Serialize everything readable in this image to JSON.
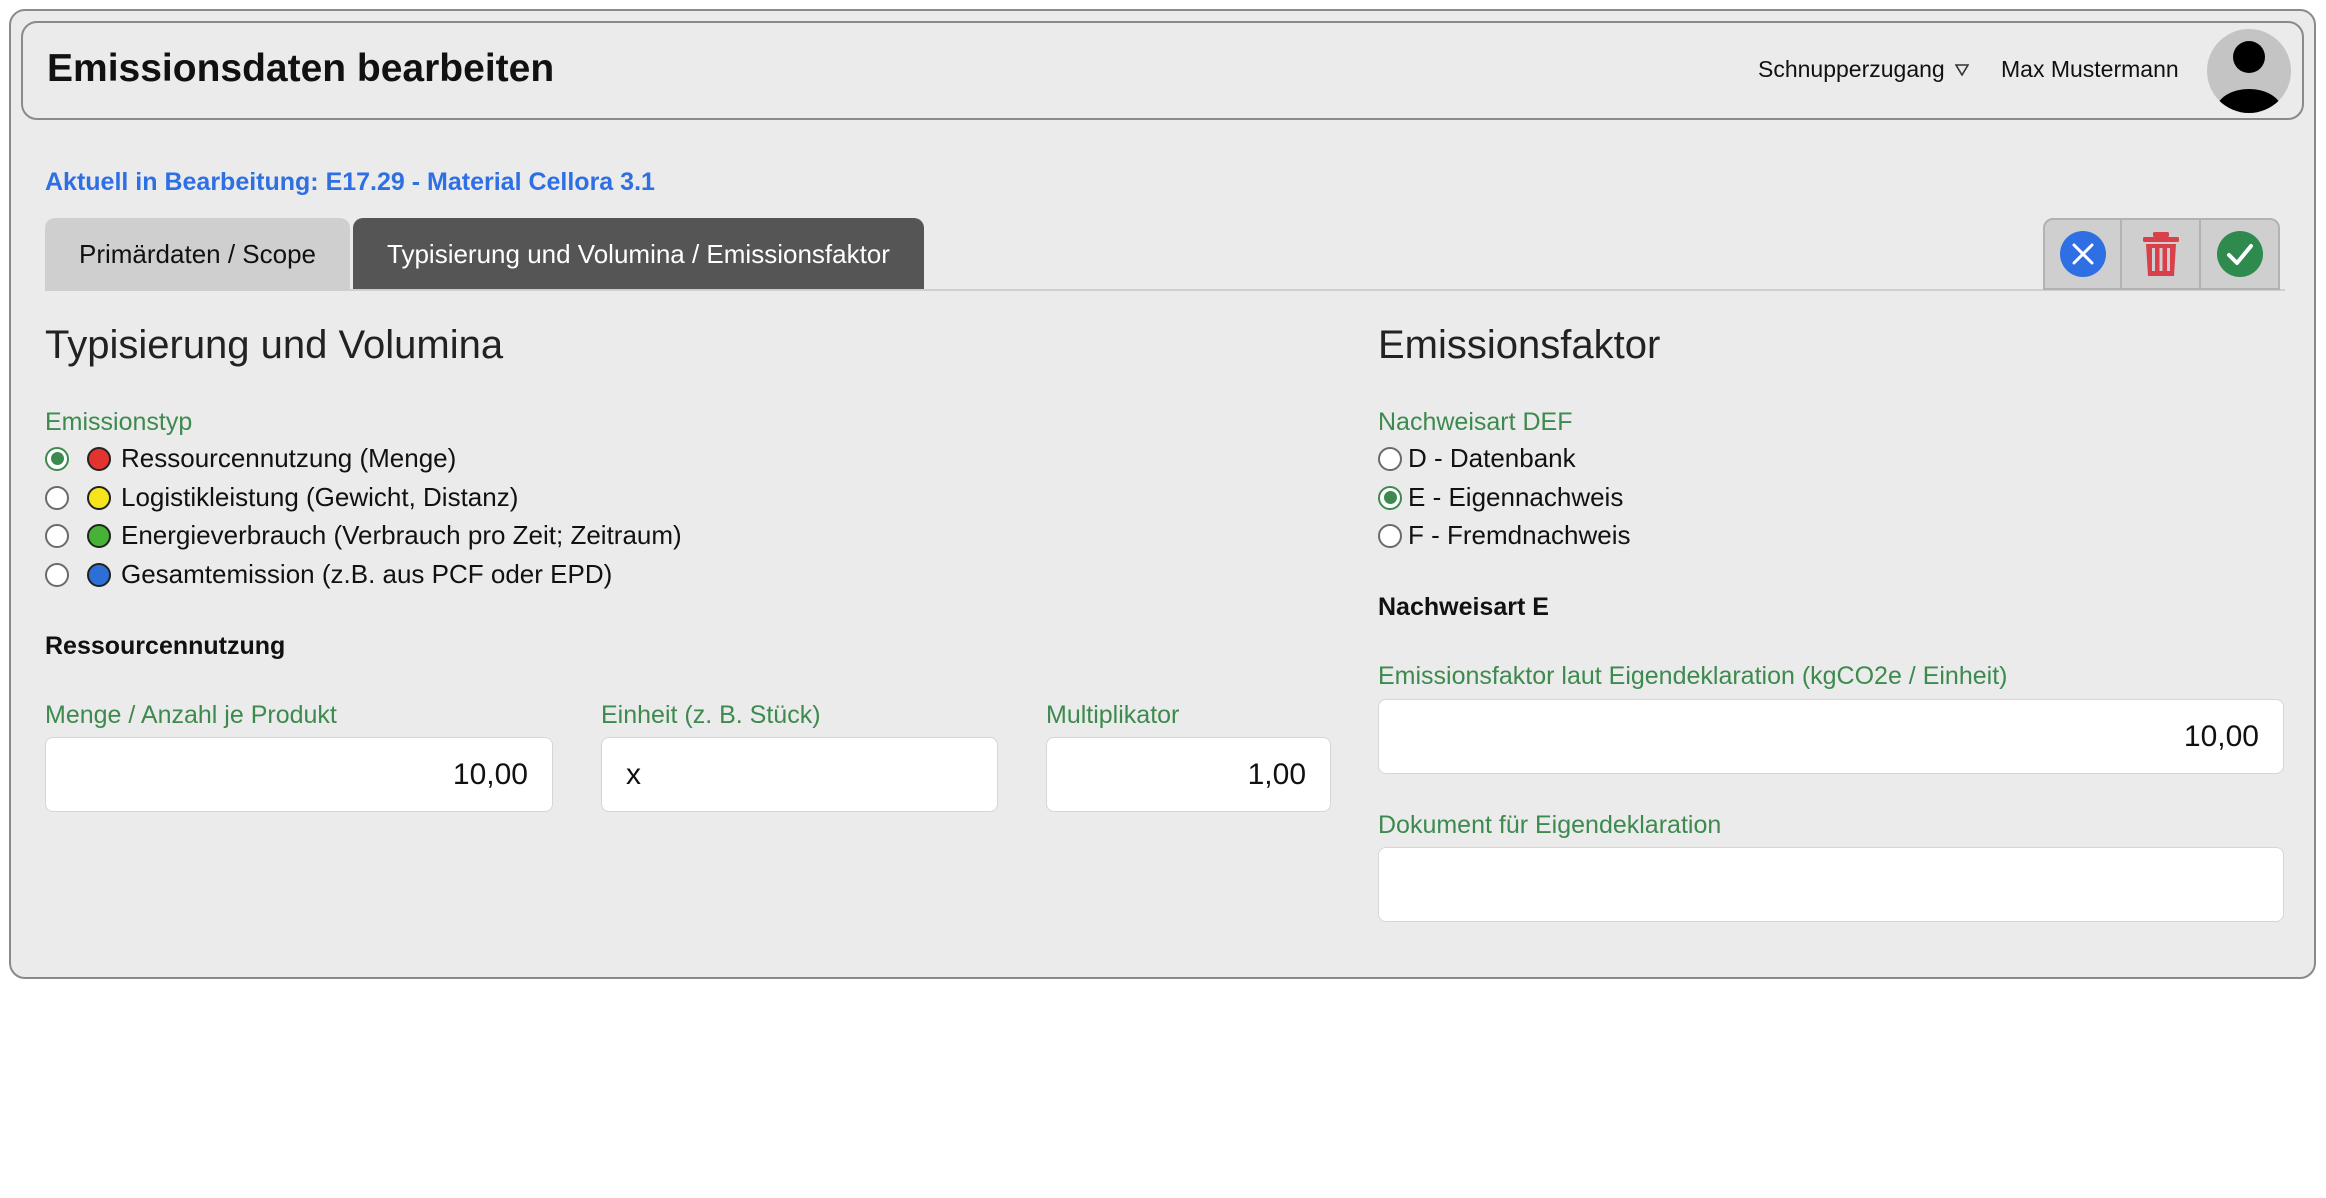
{
  "header": {
    "title": "Emissionsdaten bearbeiten",
    "account": "Schnupperzugang",
    "user_name": "Max Mustermann"
  },
  "editing": "Aktuell in Bearbeitung: E17.29 - Material Cellora 3.1",
  "tabs": [
    {
      "label": "Primärdaten / Scope",
      "active": false
    },
    {
      "label": "Typisierung und Volumina / Emissionsfaktor",
      "active": true
    }
  ],
  "actions": {
    "cancel_icon": "close-icon",
    "delete_icon": "trash-icon",
    "confirm_icon": "check-icon"
  },
  "left": {
    "title": "Typisierung und Volumina",
    "emission_type_label": "Emissionstyp",
    "emission_types": [
      {
        "label": "Ressourcennutzung (Menge)",
        "color": "#e2332e",
        "checked": true
      },
      {
        "label": "Logistikleistung (Gewicht, Distanz)",
        "color": "#f5e51d",
        "checked": false
      },
      {
        "label": "Energieverbrauch (Verbrauch pro Zeit; Zeitraum)",
        "color": "#46b336",
        "checked": false
      },
      {
        "label": "Gesamtemission (z.B. aus PCF oder EPD)",
        "color": "#2d6fd6",
        "checked": false
      }
    ],
    "subsection": "Ressourcennutzung",
    "fields": {
      "quantity_label": "Menge / Anzahl je Produkt",
      "quantity_value": "10,00",
      "unit_label": "Einheit (z. B. Stück)",
      "unit_value": "x",
      "multiplier_label": "Multiplikator",
      "multiplier_value": "1,00"
    }
  },
  "right": {
    "title": "Emissionsfaktor",
    "proof_label": "Nachweisart DEF",
    "proof_options": [
      {
        "label": "D - Datenbank",
        "checked": false
      },
      {
        "label": "E - Eigennachweis",
        "checked": true
      },
      {
        "label": "F - Fremdnachweis",
        "checked": false
      }
    ],
    "subsection": "Nachweisart E",
    "factor_label": "Emissionsfaktor laut Eigendeklaration (kgCO2e / Einheit)",
    "factor_value": "10,00",
    "document_label": "Dokument für Eigendeklaration",
    "document_value": ""
  },
  "colors": {
    "accent_green": "#3d8a4e",
    "accent_blue": "#2f6fe4",
    "delete_red": "#d9414a",
    "confirm_green": "#2f8a4e"
  }
}
